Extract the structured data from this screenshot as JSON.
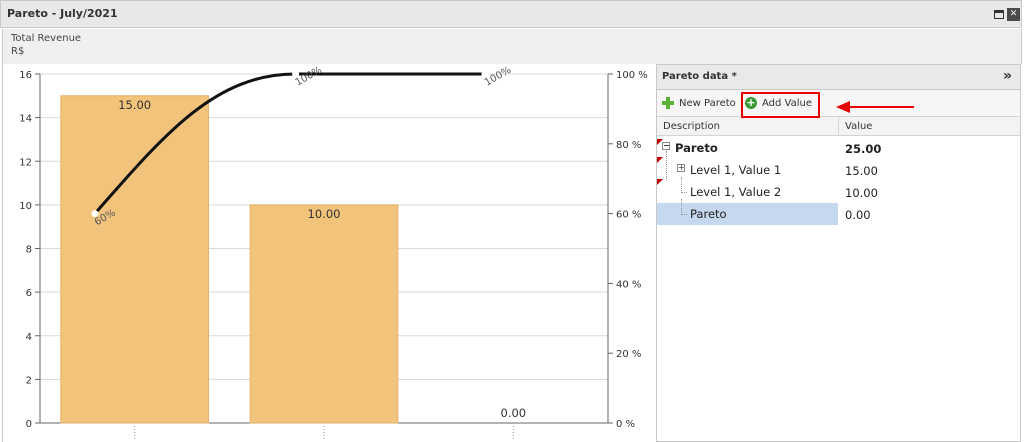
{
  "window": {
    "title": "Pareto - July/2021"
  },
  "subheader": {
    "line1": "Total Revenue",
    "line2": "R$"
  },
  "chart_data": {
    "type": "bar",
    "categories": [
      "Level 1, Value 1",
      "Level 1, Value 2",
      "Pareto"
    ],
    "values": [
      15.0,
      10.0,
      0.0
    ],
    "value_labels": [
      "15.00",
      "10.00",
      "0.00"
    ],
    "cumulative_percent": [
      60,
      100,
      100
    ],
    "cumulative_labels": [
      "60%",
      "100%",
      "100%"
    ],
    "ylim": [
      0,
      16
    ],
    "y_ticks": [
      "0",
      "2",
      "4",
      "6",
      "8",
      "10",
      "12",
      "14",
      "16"
    ],
    "y2lim": [
      0,
      100
    ],
    "y2_ticks": [
      "0 %",
      "20 %",
      "40 %",
      "60 %",
      "80 %",
      "100 %"
    ],
    "bar_color": "#f2c37b",
    "line_color": "#111111",
    "grid": true
  },
  "panel": {
    "title": "Pareto data *",
    "collapse_icon": "double-chevron-right-icon",
    "toolbar": {
      "new_label": "New Pareto",
      "add_label": "Add Value"
    },
    "columns": {
      "description": "Description",
      "value": "Value"
    },
    "rows": [
      {
        "description": "Pareto",
        "value": "25.00"
      },
      {
        "description": "Level 1, Value 1",
        "value": "15.00"
      },
      {
        "description": "Level 1, Value 2",
        "value": "10.00"
      },
      {
        "description": "Pareto",
        "value": "0.00"
      }
    ]
  },
  "annotation_color": "#e60000"
}
